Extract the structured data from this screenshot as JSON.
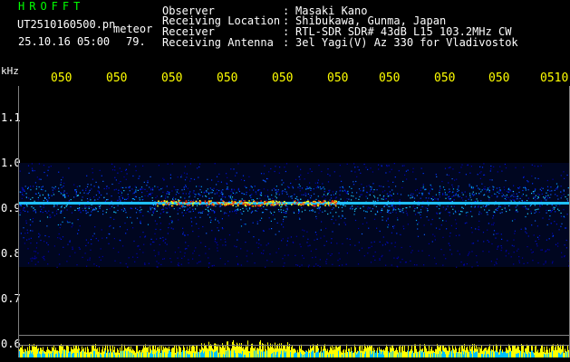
{
  "header": {
    "brand": "HROFFT",
    "filename": "UT2510160500.pn",
    "tag": "meteor",
    "datetime": "25.10.16 05:00",
    "value": "79.",
    "rows": [
      {
        "label": "Observer",
        "sep": ":",
        "value": "Masaki Kano"
      },
      {
        "label": "Receiving Location",
        "sep": ":",
        "value": "Shibukawa, Gunma, Japan"
      },
      {
        "label": "Receiver",
        "sep": ":",
        "value": "RTL-SDR SDR# 43dB L15 103.2MHz CW"
      },
      {
        "label": "Receiving Antenna",
        "sep": ":",
        "value": "3el Yagi(V) Az 330 for Vladivostok"
      }
    ]
  },
  "axes": {
    "yunit": "kHz",
    "yticks": [
      "1.1",
      "1.0",
      "0.9",
      "0.8",
      "0.7",
      "0.6"
    ],
    "xticks": [
      "050",
      "050",
      "050",
      "050",
      "050",
      "050",
      "050",
      "050",
      "050",
      "0510"
    ]
  },
  "colors": {
    "label_text": "#ffffff",
    "brand_text": "#00ff00",
    "tick_text": "#ffff00",
    "background": "#000000",
    "frame": "#7f7f7f"
  }
}
